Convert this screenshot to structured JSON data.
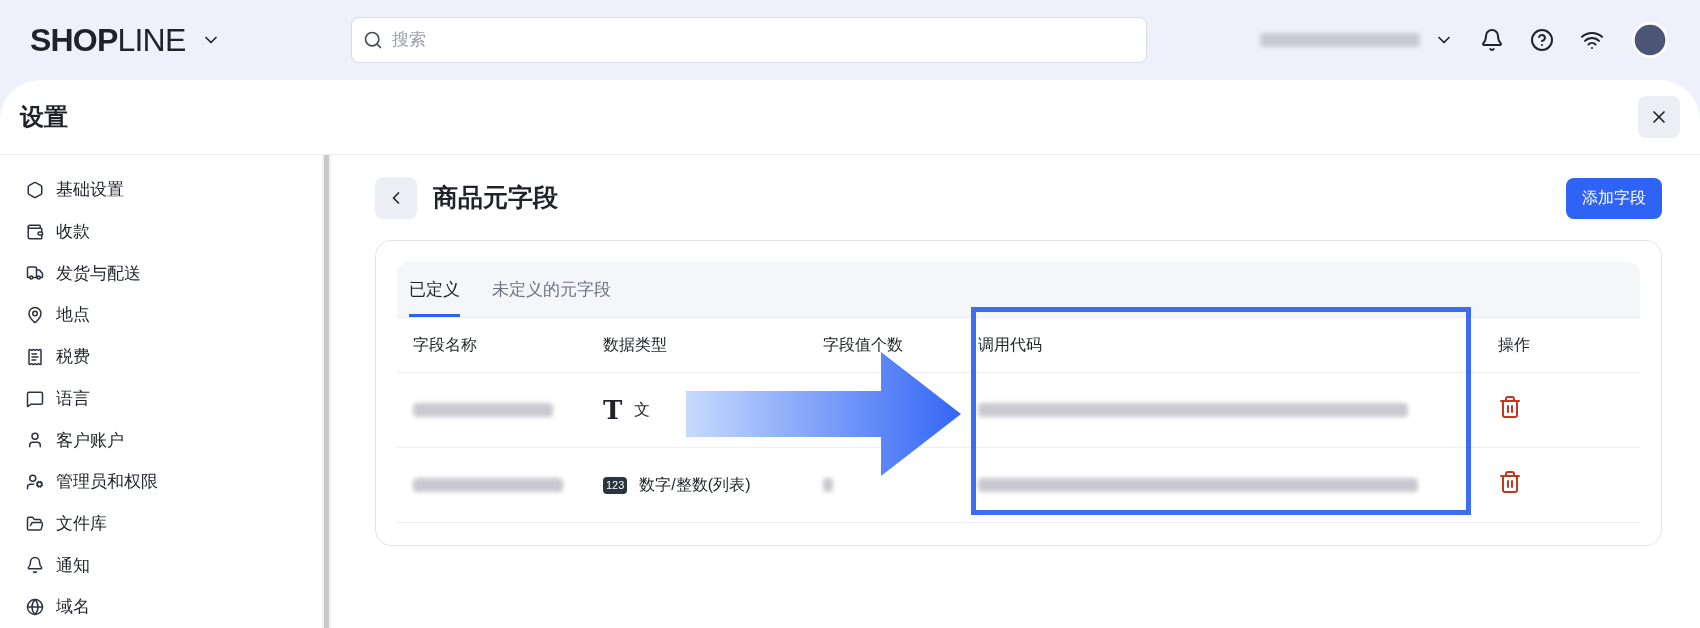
{
  "header": {
    "logo": {
      "bold": "SHOP",
      "light": "LINE"
    },
    "search": {
      "placeholder": "搜索"
    }
  },
  "panel": {
    "title": "设置"
  },
  "sidebar": {
    "items": [
      {
        "label": "基础设置"
      },
      {
        "label": "收款"
      },
      {
        "label": "发货与配送"
      },
      {
        "label": "地点"
      },
      {
        "label": "税费"
      },
      {
        "label": "语言"
      },
      {
        "label": "客户账户"
      },
      {
        "label": "管理员和权限"
      },
      {
        "label": "文件库"
      },
      {
        "label": "通知"
      },
      {
        "label": "域名"
      }
    ]
  },
  "page": {
    "title": "商品元字段",
    "add_button": "添加字段"
  },
  "tabs": [
    {
      "label": "已定义",
      "selected": true
    },
    {
      "label": "未定义的元字段",
      "selected": false
    }
  ],
  "table": {
    "columns": [
      "字段名称",
      "数据类型",
      "字段值个数",
      "调用代码",
      "操作"
    ],
    "rows": [
      {
        "kind": "text",
        "type_icon": "T",
        "type": "文"
      },
      {
        "kind": "number",
        "type_icon": "123",
        "type": "数字/整数(列表)"
      }
    ]
  }
}
